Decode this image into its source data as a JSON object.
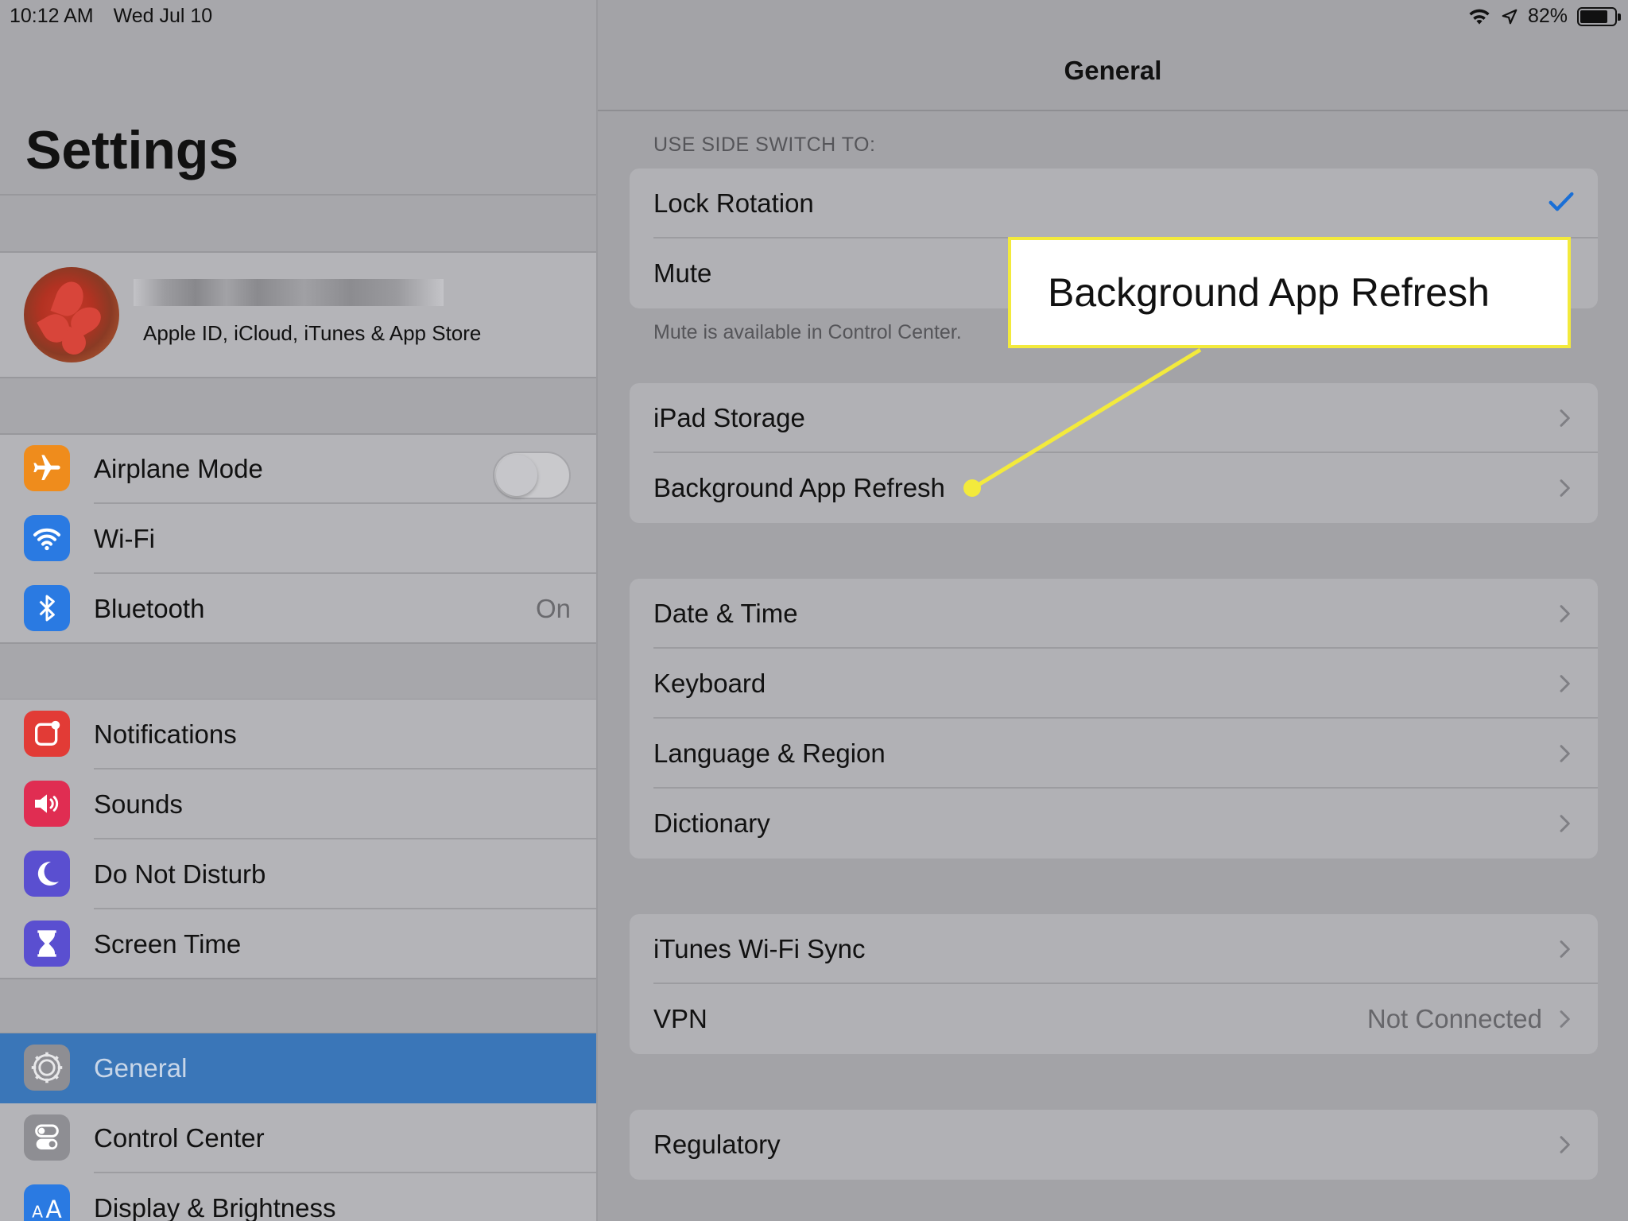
{
  "status_bar": {
    "time": "10:12 AM",
    "date": "Wed Jul 10",
    "battery": "82%",
    "battery_level": 0.82,
    "icons": [
      "wifi-icon",
      "location-icon",
      "battery-icon"
    ]
  },
  "sidebar": {
    "title": "Settings",
    "profile": {
      "subtitle": "Apple ID, iCloud, iTunes & App Store"
    },
    "groups": [
      [
        {
          "label": "Airplane Mode",
          "icon": "airplane-icon",
          "color": "#ef8c1c",
          "toggle": false
        },
        {
          "label": "Wi-Fi",
          "icon": "wifi-icon",
          "color": "#2a7ae2"
        },
        {
          "label": "Bluetooth",
          "icon": "bluetooth-icon",
          "color": "#2a7ae2",
          "value": "On"
        }
      ],
      [
        {
          "label": "Notifications",
          "icon": "notifications-icon",
          "color": "#e23b36"
        },
        {
          "label": "Sounds",
          "icon": "speaker-icon",
          "color": "#e02d52"
        },
        {
          "label": "Do Not Disturb",
          "icon": "moon-icon",
          "color": "#5a4fd0"
        },
        {
          "label": "Screen Time",
          "icon": "hourglass-icon",
          "color": "#5a4fd0"
        }
      ],
      [
        {
          "label": "General",
          "icon": "gear-icon",
          "color": "#8e8e93",
          "selected": true
        },
        {
          "label": "Control Center",
          "icon": "switches-icon",
          "color": "#8e8e93"
        },
        {
          "label": "Display & Brightness",
          "icon": "text-size-icon",
          "color": "#2a7ae2"
        }
      ]
    ]
  },
  "detail": {
    "title": "General",
    "side_switch_header": "USE SIDE SWITCH TO:",
    "side_switch_rows": [
      {
        "label": "Lock Rotation",
        "checked": true
      },
      {
        "label": "Mute",
        "checked": false
      }
    ],
    "side_switch_footer": "Mute is available in Control Center.",
    "group2": [
      {
        "label": "iPad Storage"
      },
      {
        "label": "Background App Refresh"
      }
    ],
    "group3": [
      {
        "label": "Date & Time"
      },
      {
        "label": "Keyboard"
      },
      {
        "label": "Language & Region"
      },
      {
        "label": "Dictionary"
      }
    ],
    "group4": [
      {
        "label": "iTunes Wi-Fi Sync"
      },
      {
        "label": "VPN",
        "value": "Not Connected"
      }
    ],
    "group5": [
      {
        "label": "Regulatory"
      }
    ]
  },
  "callout": {
    "text": "Background App Refresh",
    "border_color": "#f3ea3c"
  }
}
